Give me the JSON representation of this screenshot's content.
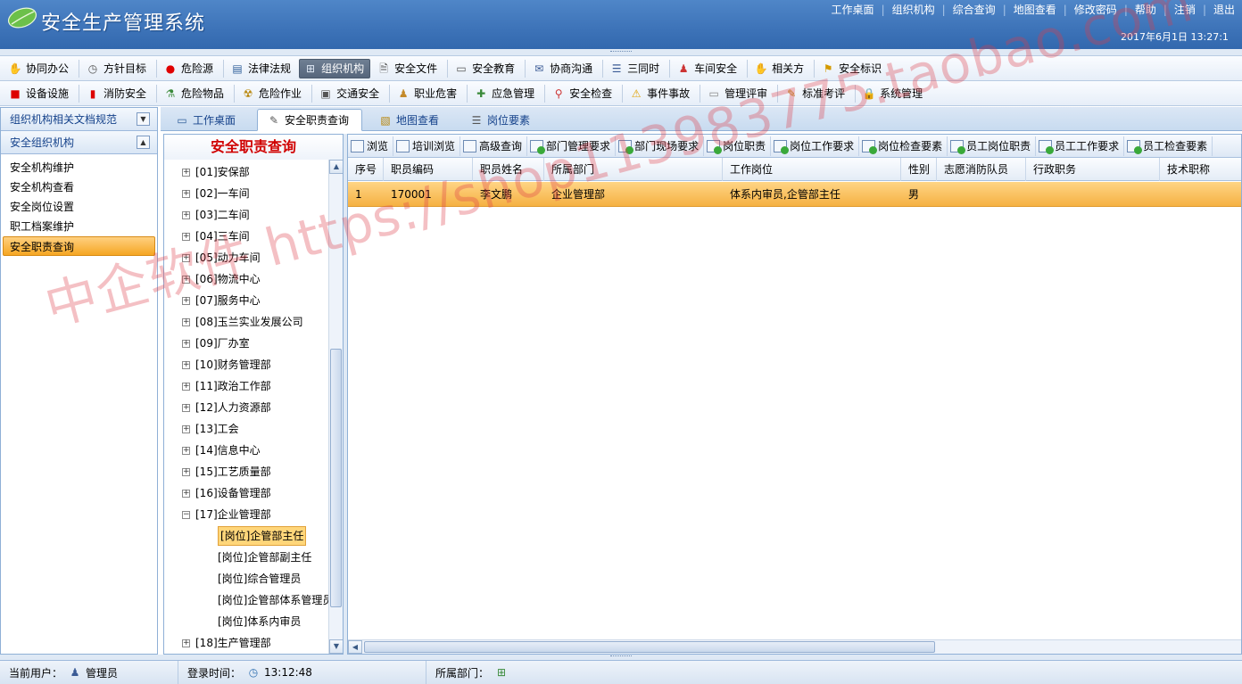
{
  "app": {
    "title": "安全生产管理系统",
    "date": "2017年6月1日 13:27:1"
  },
  "top_links": [
    "工作桌面",
    "组织机构",
    "综合查询",
    "地图查看",
    "修改密码",
    "帮助",
    "注销",
    "退出"
  ],
  "menu_row1": [
    {
      "label": "协同办公",
      "icon": "handshake-icon"
    },
    {
      "label": "方针目标",
      "icon": "clock-icon"
    },
    {
      "label": "危险源",
      "icon": "red-dot-icon"
    },
    {
      "label": "法律法规",
      "icon": "document-list-icon"
    },
    {
      "label": "组织机构",
      "icon": "org-chart-icon",
      "active": true
    },
    {
      "label": "安全文件",
      "icon": "file-icon"
    },
    {
      "label": "安全教育",
      "icon": "speech-bubble-icon"
    },
    {
      "label": "协商沟通",
      "icon": "mail-icon"
    },
    {
      "label": "三同时",
      "icon": "list-icon"
    },
    {
      "label": "车间安全",
      "icon": "worker-icon"
    },
    {
      "label": "相关方",
      "icon": "handshake-icon"
    },
    {
      "label": "安全标识",
      "icon": "flag-icon"
    }
  ],
  "menu_row2": [
    {
      "label": "设备设施",
      "icon": "device-icon"
    },
    {
      "label": "消防安全",
      "icon": "fire-extinguisher-icon"
    },
    {
      "label": "危险物品",
      "icon": "flask-icon"
    },
    {
      "label": "危险作业",
      "icon": "hazard-icon"
    },
    {
      "label": "交通安全",
      "icon": "traffic-icon"
    },
    {
      "label": "职业危害",
      "icon": "worker-icon"
    },
    {
      "label": "应急管理",
      "icon": "emergency-icon"
    },
    {
      "label": "安全检查",
      "icon": "magnifier-icon"
    },
    {
      "label": "事件事故",
      "icon": "warning-icon"
    },
    {
      "label": "管理评审",
      "icon": "review-icon"
    },
    {
      "label": "标准考评",
      "icon": "pencil-icon"
    },
    {
      "label": "系统管理",
      "icon": "lock-icon"
    }
  ],
  "sidebar": {
    "section1": "组织机构相关文档规范",
    "section2": "安全组织机构",
    "items": [
      "安全机构维护",
      "安全机构查看",
      "安全岗位设置",
      "职工档案维护",
      "安全职责查询"
    ],
    "selected_index": 4
  },
  "tabs": [
    {
      "label": "工作桌面",
      "icon": "desktop-icon"
    },
    {
      "label": "安全职责查询",
      "icon": "edit-doc-icon",
      "active": true
    },
    {
      "label": "地图查看",
      "icon": "map-icon"
    },
    {
      "label": "岗位要素",
      "icon": "list-icon"
    }
  ],
  "tree": {
    "title": "安全职责查询",
    "nodes_before": [
      "[01]安保部",
      "[02]一车间",
      "[03]二车间",
      "[04]三车间",
      "[05]动力车间",
      "[06]物流中心",
      "[07]服务中心",
      "[08]玉兰实业发展公司",
      "[09]厂办室",
      "[10]财务管理部",
      "[11]政治工作部",
      "[12]人力资源部",
      "[13]工会",
      "[14]信息中心",
      "[15]工艺质量部",
      "[16]设备管理部"
    ],
    "expanded_node": "[17]企业管理部",
    "children": [
      "[岗位]企管部主任",
      "[岗位]企管部副主任",
      "[岗位]综合管理员",
      "[岗位]企管部体系管理员",
      "[岗位]体系内审员"
    ],
    "selected_child": 0,
    "node_after": "[18]生产管理部"
  },
  "grid_toolbar": [
    "浏览",
    "培训浏览",
    "高级查询",
    "部门管理要求",
    "部门现场要求",
    "岗位职责",
    "岗位工作要求",
    "岗位检查要素",
    "员工岗位职责",
    "员工工作要求",
    "员工检查要素"
  ],
  "grid": {
    "columns": [
      "序号",
      "职员编码",
      "职员姓名",
      "所属部门",
      "工作岗位",
      "性别",
      "志愿消防队员",
      "行政职务",
      "技术职称"
    ],
    "rows": [
      [
        "1",
        "170001",
        "李文鹏",
        "企业管理部",
        "体系内审员,企管部主任",
        "男",
        "",
        "",
        ""
      ]
    ]
  },
  "status": {
    "user_label": "当前用户：",
    "user": "管理员",
    "login_label": "登录时间：",
    "login_time": "13:12:48",
    "dept_label": "所属部门："
  },
  "watermark": "中企软件 https://shop113983775.taobao.com"
}
